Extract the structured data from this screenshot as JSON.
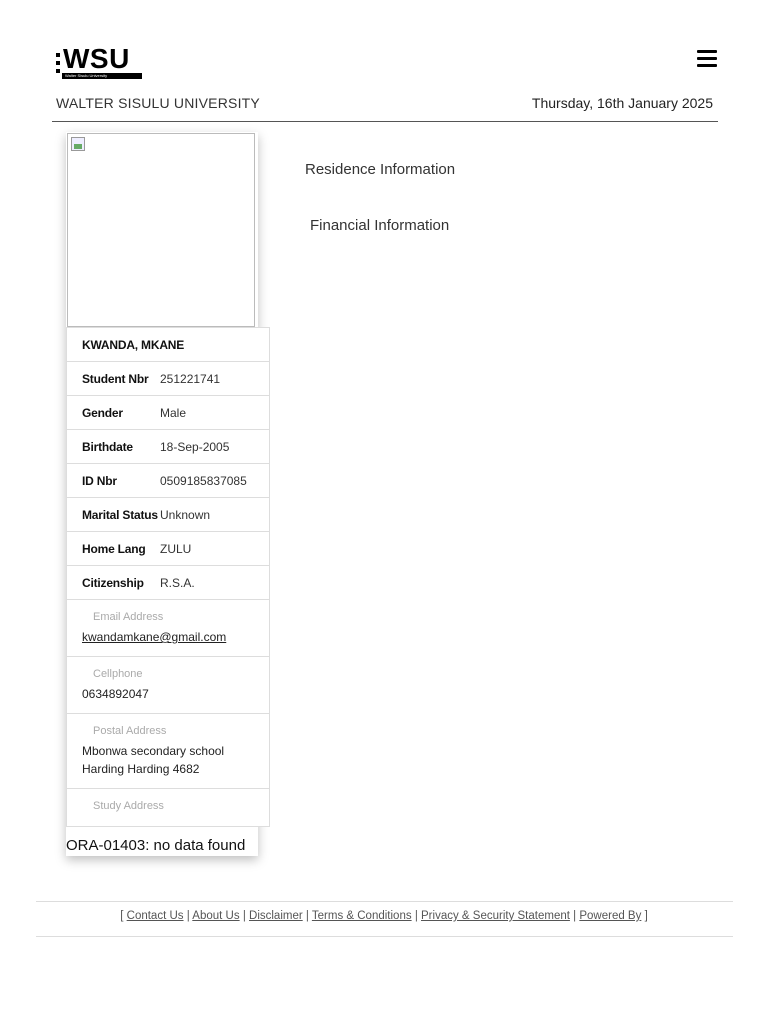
{
  "header": {
    "logo_text": "WSU",
    "logo_strip": "Walter Sisulu University",
    "university_name": "WALTER SISULU UNIVERSITY",
    "date": "Thursday, 16th January 2025",
    "menu_icon": "hamburger-icon"
  },
  "profile": {
    "name": "KWANDA, MKANE",
    "fields": [
      {
        "label": "Student Nbr",
        "value": "251221741"
      },
      {
        "label": "Gender",
        "value": "Male"
      },
      {
        "label": "Birthdate",
        "value": "18-Sep-2005"
      },
      {
        "label": "ID Nbr",
        "value": "0509185837085"
      },
      {
        "label": "Marital Status",
        "value": "Unknown"
      },
      {
        "label": "Home Lang",
        "value": "ZULU"
      },
      {
        "label": "Citizenship",
        "value": "R.S.A."
      }
    ],
    "email_label": "Email Address",
    "email": "kwandamkane@gmail.com",
    "cell_label": "Cellphone",
    "cell": "0634892047",
    "postal_label": "Postal Address",
    "postal_line1": "Mbonwa secondary school",
    "postal_line2": "Harding Harding 4682",
    "study_label": "Study Address",
    "error": "ORA-01403: no data found"
  },
  "main": {
    "residence_link": "Residence Information",
    "financial_link": "Financial Information"
  },
  "footer": {
    "open": "[",
    "close": "]",
    "sep": "|",
    "links": [
      "Contact Us",
      "About Us",
      "Disclaimer",
      "Terms & Conditions",
      "Privacy & Security Statement",
      "Powered By"
    ]
  }
}
